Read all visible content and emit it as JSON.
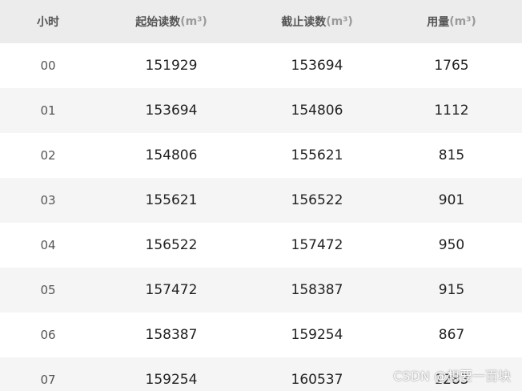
{
  "table": {
    "columns": [
      {
        "label": "小时",
        "unit": ""
      },
      {
        "label": "起始读数",
        "unit": "(m³)"
      },
      {
        "label": "截止读数",
        "unit": "(m³)"
      },
      {
        "label": "用量",
        "unit": "(m³)"
      }
    ],
    "rows": [
      [
        "00",
        "151929",
        "153694",
        "1765"
      ],
      [
        "01",
        "153694",
        "154806",
        "1112"
      ],
      [
        "02",
        "154806",
        "155621",
        "815"
      ],
      [
        "03",
        "155621",
        "156522",
        "901"
      ],
      [
        "04",
        "156522",
        "157472",
        "950"
      ],
      [
        "05",
        "157472",
        "158387",
        "915"
      ],
      [
        "06",
        "158387",
        "159254",
        "867"
      ],
      [
        "07",
        "159254",
        "160537",
        "1283"
      ]
    ]
  },
  "watermark": "CSDN @想要一百块",
  "colors": {
    "header_bg": "#ececec",
    "row_alt_bg": "#f5f5f5",
    "unit_text": "#9a9a9a"
  }
}
